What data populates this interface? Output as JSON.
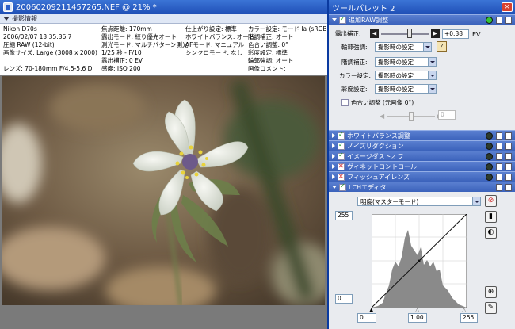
{
  "image_window": {
    "title": "20060209211457265.NEF @ 21% *",
    "info_header": "撮影情報",
    "col1": [
      "Nikon D70s",
      "2006/02/07 13:35:36.7",
      "圧縮 RAW (12-bit)",
      "画像サイズ: Large (3008 x 2000)"
    ],
    "col1_lens": "レンズ: 70-180mm F/4.5-5.6 D",
    "col2": [
      "焦点距離: 170mm",
      "露出モード: 絞り優先オート",
      "測光モード: マルチパターン測光",
      "1/25 秒 - F/10",
      "露出補正: 0 EV",
      "感度: ISO 200"
    ],
    "col3": [
      "仕上がり設定: 標準",
      "ホワイトバランス: オート",
      "AFモード: マニュアル",
      "シンクロモード: なし"
    ],
    "col4": [
      "カラー設定: モード Ia (sRGB)",
      "階調補正: オート",
      "色合い調整: 0°",
      "彩度設定: 標準",
      "輪郭強調: オート",
      "画像コメント:"
    ]
  },
  "palette": {
    "title": "ツールパレット 2",
    "close": "×",
    "raw_section": {
      "label": "追加RAW調整",
      "exposure_label": "露出補正:",
      "exposure_value": "+0.38",
      "exposure_unit": "EV",
      "exposure_fraction": 0.6,
      "sharpen_label": "輪郭強調:",
      "sharpen_value": "撮影時の設定",
      "tone_label": "階調補正:",
      "tone_value": "撮影時の設定",
      "color_label": "カラー設定:",
      "color_value": "撮影時の設定",
      "saturation_label": "彩度設定:",
      "saturation_value": "撮影時の設定",
      "hue_label": "色合い調整 (元画像 0°)",
      "hue_value": "0"
    },
    "sections": [
      {
        "label": "ホワイトバランス調整",
        "check": "on"
      },
      {
        "label": "ノイズリダクション",
        "check": "on"
      },
      {
        "label": "イメージダストオフ",
        "check": "on"
      },
      {
        "label": "ヴィネットコントロール",
        "check": "x"
      },
      {
        "label": "フィッシュアイレンズ",
        "check": "x"
      }
    ],
    "lch": {
      "label": "LCHエディタ",
      "mode": "明度(マスターモード)",
      "top_value": "255",
      "bottom_value": "0",
      "axis_left": "0",
      "axis_mid": "1.00",
      "axis_right": "255"
    }
  },
  "colors": {
    "titlebar": "#1f4fb6",
    "section": "#3b62bb",
    "check": "#1a9a1a",
    "x": "#d02020"
  }
}
